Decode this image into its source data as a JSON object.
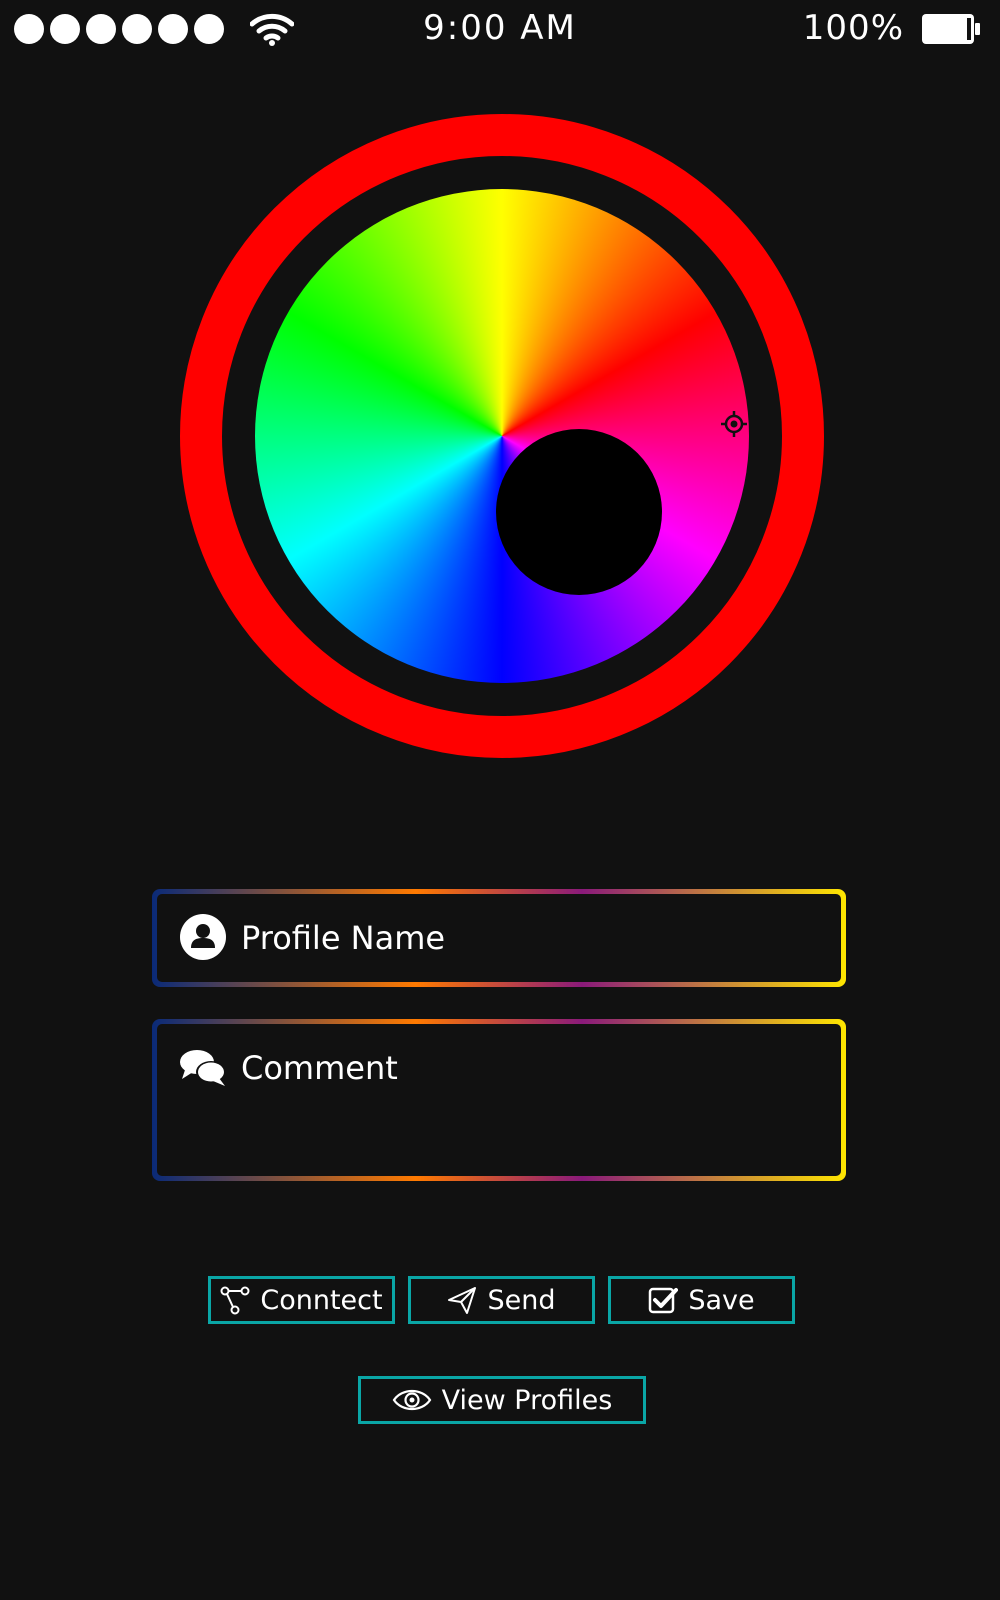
{
  "status_bar": {
    "time": "9:00 AM",
    "battery_percent": "100%",
    "signal_dots": 6,
    "battery_level": 0.9
  },
  "color_wheel": {
    "outer_ring_color": "#ff0000",
    "selected_hue": "#ff0000"
  },
  "form": {
    "profile_name": {
      "placeholder": "Profile Name",
      "value": "",
      "icon": "user-icon"
    },
    "comment": {
      "placeholder": "Comment",
      "value": "",
      "icon": "comments-icon"
    },
    "border_gradient": [
      "#0a2a78",
      "#ff7a00",
      "#8a1a7a",
      "#ffe600"
    ]
  },
  "buttons": {
    "connect": {
      "label": "Conntect",
      "icon": "share-nodes-icon"
    },
    "send": {
      "label": "Send",
      "icon": "paper-plane-icon"
    },
    "save": {
      "label": "Save",
      "icon": "check-square-icon"
    },
    "view_profiles": {
      "label": "View Profiles",
      "icon": "eye-icon"
    },
    "border_color": "#0aa6a6"
  }
}
